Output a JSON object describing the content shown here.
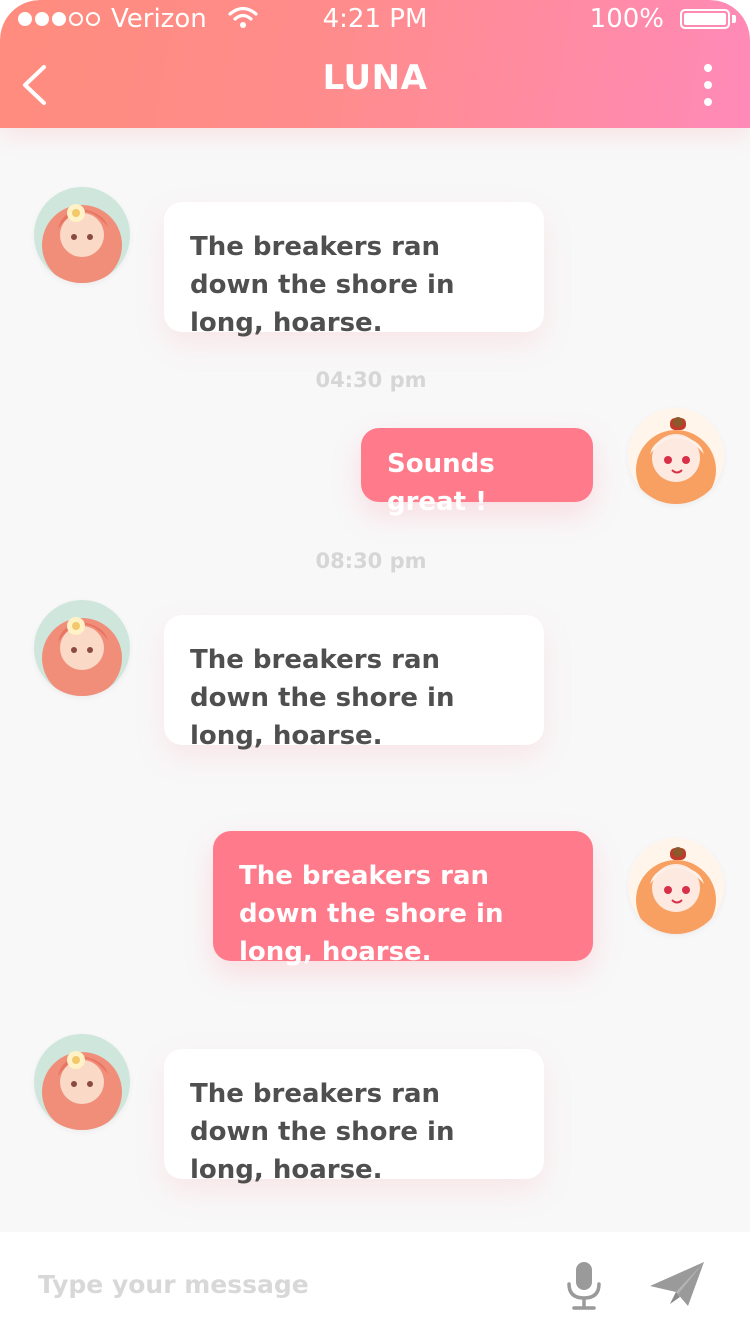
{
  "status_bar": {
    "carrier": "Verizon",
    "time": "4:21 PM",
    "battery": "100%"
  },
  "header": {
    "title": "LUNA",
    "back_icon": "chevron-left-icon",
    "menu_icon": "more-vertical-icon"
  },
  "messages": [
    {
      "sender": "contact",
      "text": "The breakers ran down the shore in long, hoarse."
    },
    {
      "sender": "me",
      "text": "Sounds great !"
    },
    {
      "sender": "contact",
      "text": "The breakers ran down the shore in long, hoarse."
    },
    {
      "sender": "me",
      "text": "The breakers ran down the shore in long, hoarse."
    },
    {
      "sender": "contact",
      "text": "The breakers ran down the shore in long, hoarse."
    }
  ],
  "timestamps": [
    "04:30 pm",
    "08:30 pm"
  ],
  "composer": {
    "placeholder": "Type your message",
    "mic_icon": "microphone-icon",
    "send_icon": "paper-plane-icon"
  },
  "colors": {
    "header_gradient_start": "#ff8c7d",
    "header_gradient_end": "#ff8ab8",
    "outgoing_bubble": "#ff7a8a",
    "incoming_bubble": "#ffffff",
    "background": "#f8f8f9"
  }
}
